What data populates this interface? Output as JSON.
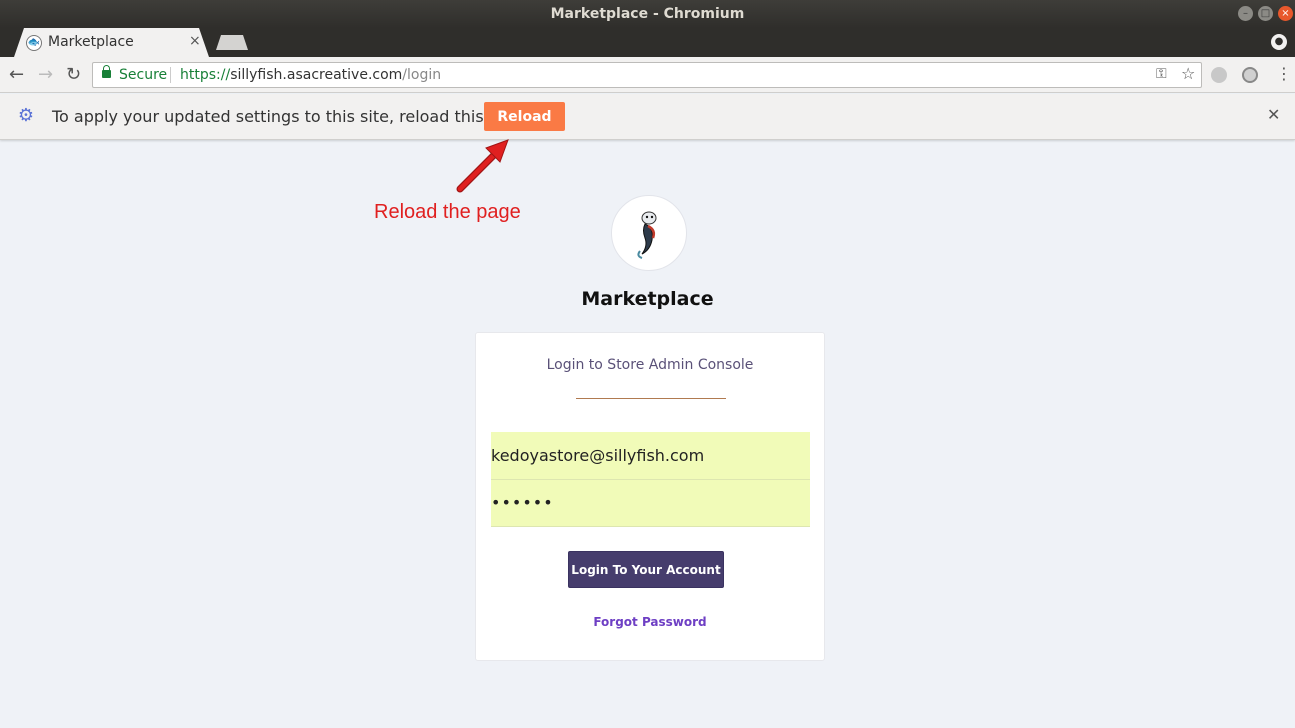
{
  "window": {
    "title": "Marketplace - Chromium",
    "minimize_glyph": "–",
    "maximize_glyph": "□",
    "close_glyph": "×"
  },
  "tab": {
    "title": "Marketplace",
    "close_glyph": "×",
    "favicon": "store-favicon"
  },
  "toolbar": {
    "back_glyph": "←",
    "forward_glyph": "→",
    "reload_glyph": "↻",
    "secure_label": "Secure",
    "url_scheme": "https://",
    "url_host": "sillyfish.asacreative.com",
    "url_path": "/login",
    "key_glyph": "⚿",
    "star_glyph": "☆",
    "menu_glyph": "⋮"
  },
  "infobar": {
    "gear_glyph": "⚙",
    "message": "To apply your updated settings to this site, reload this page",
    "reload_label": "Reload",
    "close_glyph": "✕"
  },
  "annotation": {
    "text": "Reload the page",
    "color": "#e02020"
  },
  "page": {
    "store_name": "Marketplace",
    "card_title": "Login to Store Admin Console",
    "email_value": "kedoyastore@sillyfish.com",
    "password_value": "••••••",
    "login_label": "Login To Your Account",
    "forgot_label": "Forgot Password"
  },
  "colors": {
    "reload_button": "#fa7a45",
    "login_button": "#463d6d",
    "autofill": "#f1fbb8",
    "link": "#6e3fc4",
    "background": "#eff2f7"
  }
}
